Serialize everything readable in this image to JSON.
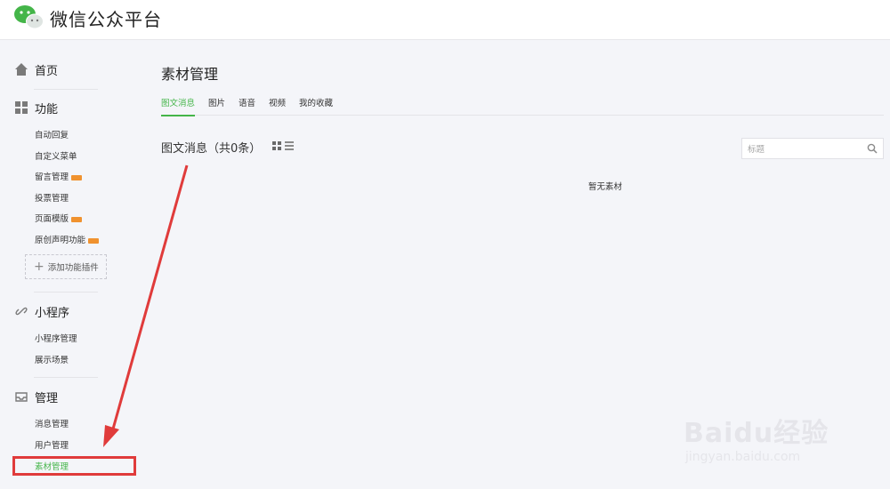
{
  "header": {
    "brand": "微信公众平台"
  },
  "sidebar": {
    "home": {
      "label": "首页"
    },
    "functions": {
      "label": "功能",
      "items": [
        {
          "label": "自动回复"
        },
        {
          "label": "自定义菜单"
        },
        {
          "label": "留言管理",
          "badge": true
        },
        {
          "label": "投票管理"
        },
        {
          "label": "页面模版",
          "badge": true
        },
        {
          "label": "原创声明功能",
          "badge": true
        }
      ],
      "add_plugin": "添加功能插件"
    },
    "miniprogram": {
      "label": "小程序",
      "items": [
        {
          "label": "小程序管理"
        },
        {
          "label": "展示场景"
        }
      ]
    },
    "manage": {
      "label": "管理",
      "items": [
        {
          "label": "消息管理"
        },
        {
          "label": "用户管理"
        },
        {
          "label": "素材管理",
          "active": true
        }
      ]
    }
  },
  "main": {
    "title": "素材管理",
    "tabs": [
      {
        "label": "图文消息",
        "active": true
      },
      {
        "label": "图片"
      },
      {
        "label": "语音"
      },
      {
        "label": "视频"
      },
      {
        "label": "我的收藏"
      }
    ],
    "section_title": "图文消息（共0条）",
    "search": {
      "placeholder": "标题",
      "value": ""
    },
    "empty_text": "暂无素材"
  },
  "watermark": {
    "main": "Baidu经验",
    "sub": "jingyan.baidu.com"
  },
  "colors": {
    "accent": "#44b549",
    "annotation": "#e03b3b",
    "badge": "#f0922f"
  }
}
